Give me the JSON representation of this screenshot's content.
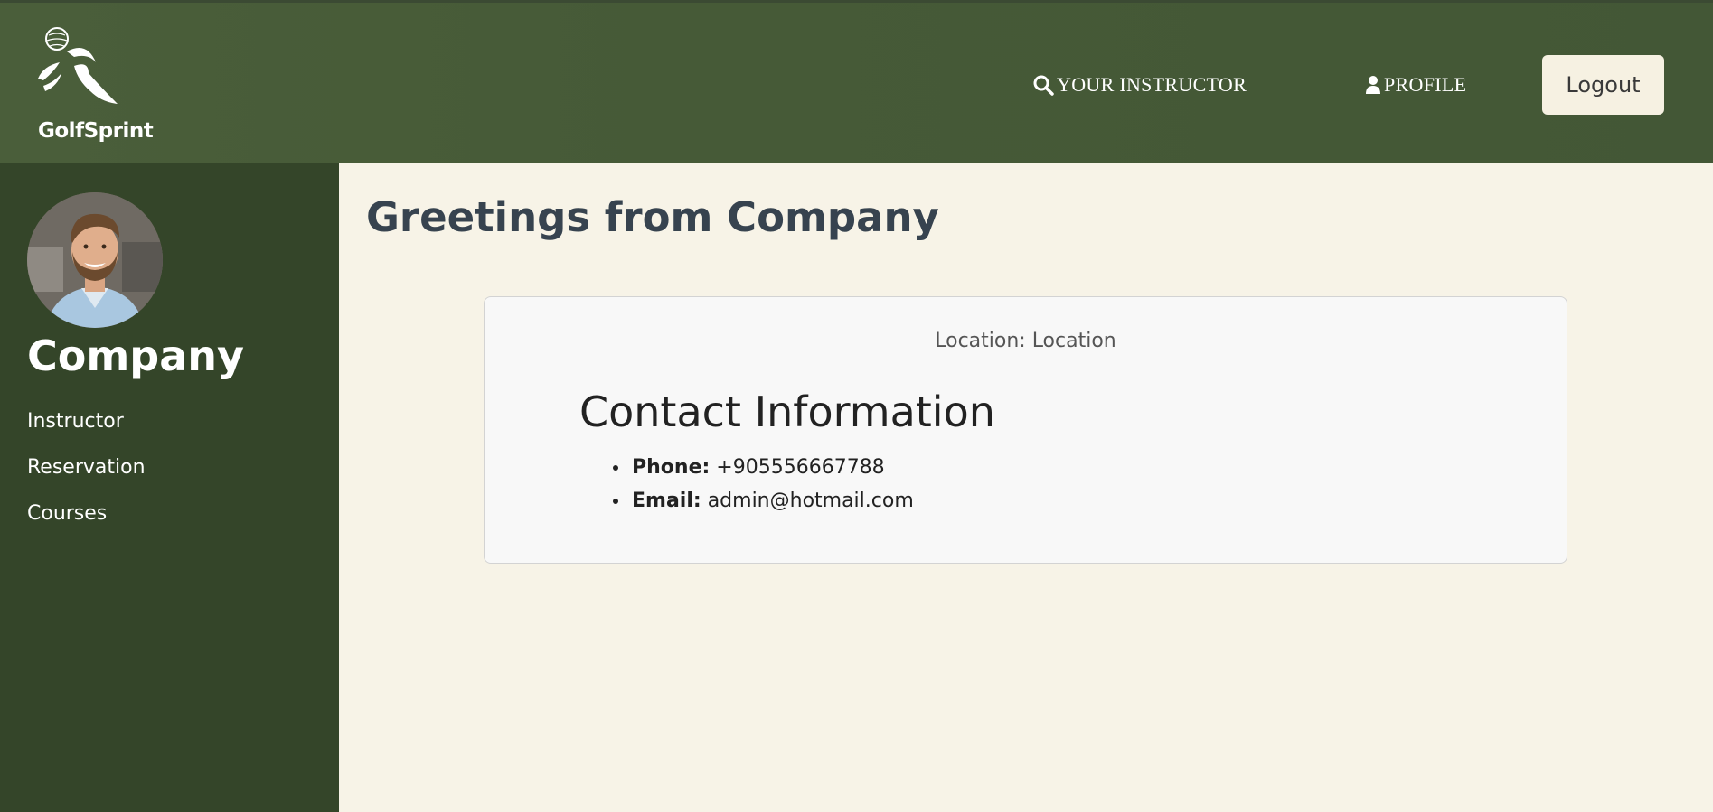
{
  "header": {
    "brand": "GolfSprint",
    "nav": {
      "instructor_label": "YOUR INSTRUCTOR",
      "profile_label": "PROFILE"
    },
    "logout_label": "Logout"
  },
  "sidebar": {
    "company_name": "Company",
    "items": [
      {
        "label": "Instructor"
      },
      {
        "label": "Reservation"
      },
      {
        "label": "Courses"
      }
    ]
  },
  "main": {
    "title": "Greetings from Company",
    "card": {
      "location_text": "Location: Location",
      "contact_heading": "Contact Information",
      "phone_label": "Phone:",
      "phone_value": "+905556667788",
      "email_label": "Email:",
      "email_value": "admin@hotmail.com"
    }
  },
  "colors": {
    "header_bg": "#465a37",
    "sidebar_bg": "#344529",
    "page_bg": "#f7f3e7",
    "card_bg": "#f8f8f8",
    "title_color": "#37434f"
  },
  "icons": {
    "logo": "golfer-logo-icon",
    "instructor": "search-icon",
    "profile": "user-icon"
  }
}
